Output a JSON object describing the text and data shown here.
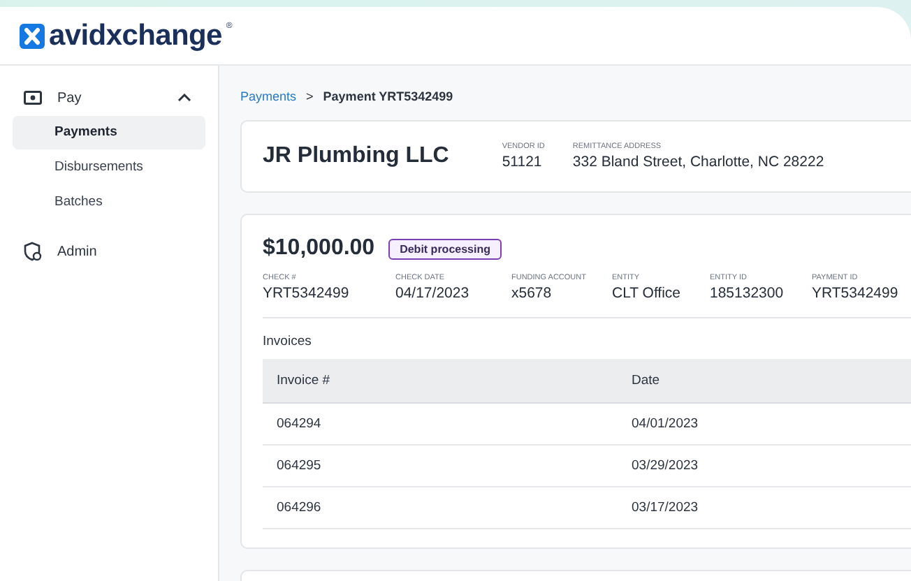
{
  "header": {
    "brand": "avidxchange",
    "brand_mark": "®"
  },
  "sidebar": {
    "sections": [
      {
        "label": "Pay",
        "expanded": true,
        "children": [
          {
            "label": "Payments",
            "selected": true
          },
          {
            "label": "Disbursements",
            "selected": false
          },
          {
            "label": "Batches",
            "selected": false
          }
        ]
      },
      {
        "label": "Admin"
      }
    ]
  },
  "breadcrumb": {
    "parent": "Payments",
    "separator": ">",
    "current": "Payment YRT5342499"
  },
  "vendor": {
    "name": "JR Plumbing LLC",
    "fields": [
      {
        "label": "VENDOR ID",
        "value": "51121"
      },
      {
        "label": "REMITTANCE ADDRESS",
        "value": "332 Bland Street, Charlotte, NC  28222"
      }
    ]
  },
  "payment": {
    "amount": "$10,000.00",
    "status": "Debit processing",
    "fields": [
      {
        "label": "CHECK #",
        "value": "YRT5342499"
      },
      {
        "label": "CHECK DATE",
        "value": "04/17/2023"
      },
      {
        "label": "FUNDING ACCOUNT",
        "value": "x5678"
      },
      {
        "label": "ENTITY",
        "value": "CLT Office"
      },
      {
        "label": "ENTITY ID",
        "value": "185132300"
      },
      {
        "label": "PAYMENT ID",
        "value": "YRT5342499"
      }
    ]
  },
  "invoices": {
    "title": "Invoices",
    "columns": [
      "Invoice #",
      "Date"
    ],
    "rows": [
      [
        "064294",
        "04/01/2023"
      ],
      [
        "064295",
        "03/29/2023"
      ],
      [
        "064296",
        "03/17/2023"
      ]
    ]
  }
}
